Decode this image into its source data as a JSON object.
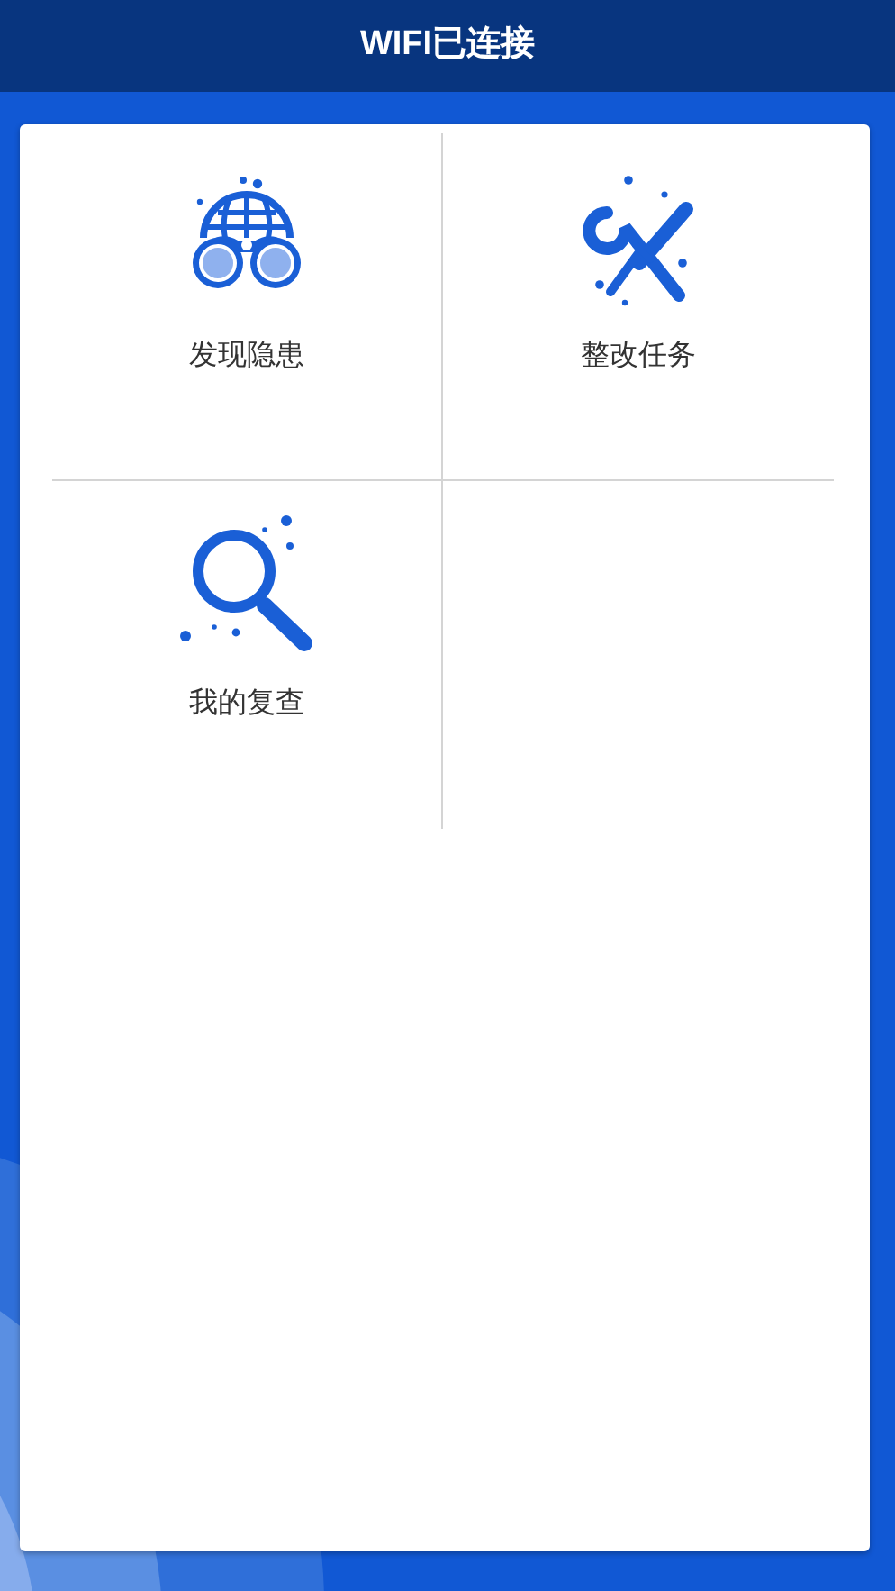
{
  "header": {
    "title": "WIFI已连接"
  },
  "menu": [
    {
      "kind": "binoculars",
      "label": "发现隐患"
    },
    {
      "kind": "tools",
      "label": "整改任务"
    },
    {
      "kind": "magnifier",
      "label": "我的复查"
    }
  ]
}
